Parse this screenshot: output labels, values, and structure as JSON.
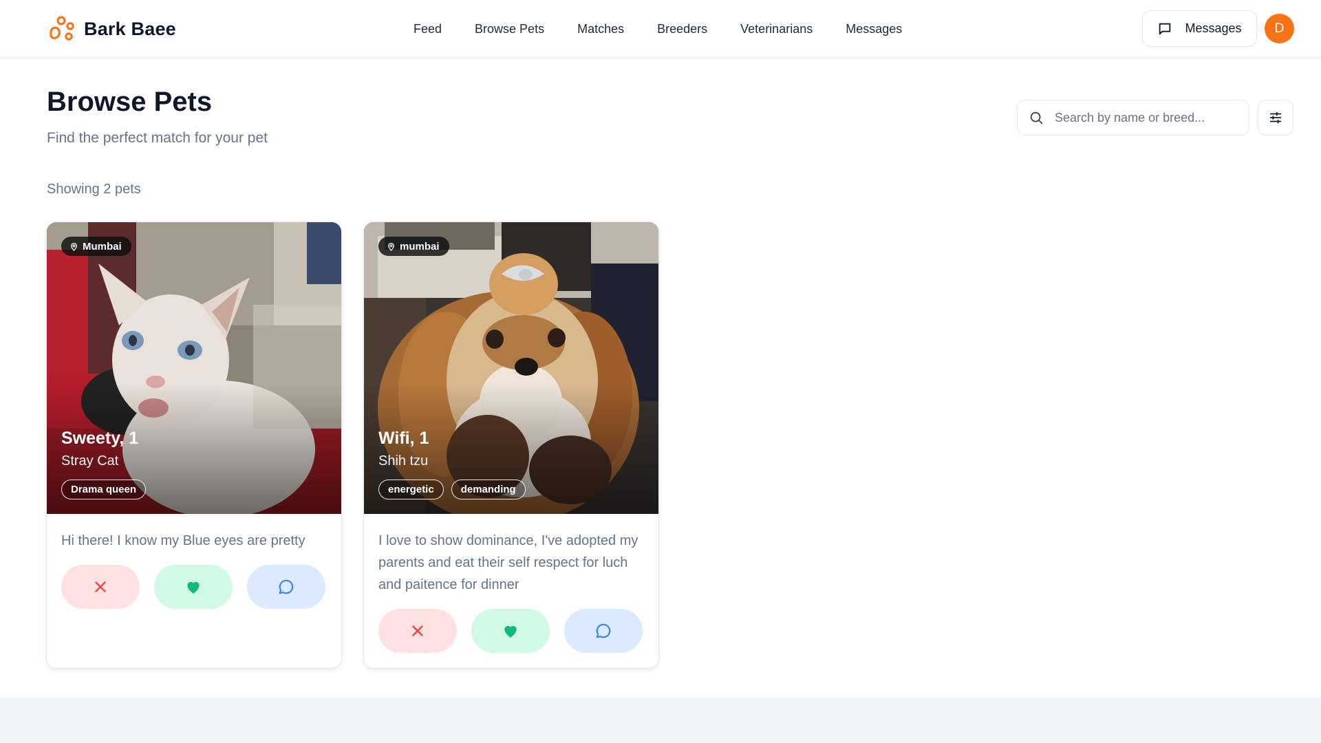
{
  "app": {
    "name": "Bark Baee",
    "brand_color": "#f97316"
  },
  "nav": {
    "items": [
      {
        "label": "Feed"
      },
      {
        "label": "Browse Pets"
      },
      {
        "label": "Matches"
      },
      {
        "label": "Breeders"
      },
      {
        "label": "Veterinarians"
      },
      {
        "label": "Messages"
      }
    ]
  },
  "header": {
    "messages_label": "Messages",
    "messages_icon": "message-square-icon",
    "avatar_initial": "D"
  },
  "page": {
    "title": "Browse Pets",
    "subtitle": "Find the perfect match for your pet",
    "count_text": "Showing 2 pets"
  },
  "search": {
    "placeholder": "Search by name or breed...",
    "value": "",
    "icon": "search-icon",
    "filter_icon": "sliders-icon"
  },
  "pets": [
    {
      "location": "Mumbai",
      "name_age": "Sweety, 1",
      "breed": "Stray Cat",
      "tags": [
        "Drama queen"
      ],
      "bio": "Hi there! I know my Blue eyes are pretty",
      "photo": "white cat with blue eyes"
    },
    {
      "location": "mumbai",
      "name_age": "Wifi, 1",
      "breed": "Shih tzu",
      "tags": [
        "energetic",
        "demanding"
      ],
      "bio": "I love to show dominance, I've adopted my parents and eat their self respect for luch and paitence for dinner",
      "photo": "shih tzu dog with bow"
    }
  ],
  "actions": {
    "pass_icon": "x-icon",
    "like_icon": "heart-icon",
    "chat_icon": "message-circle-icon",
    "pass_color": "#ef4444",
    "like_color": "#10b981",
    "chat_color": "#3b82f6"
  }
}
